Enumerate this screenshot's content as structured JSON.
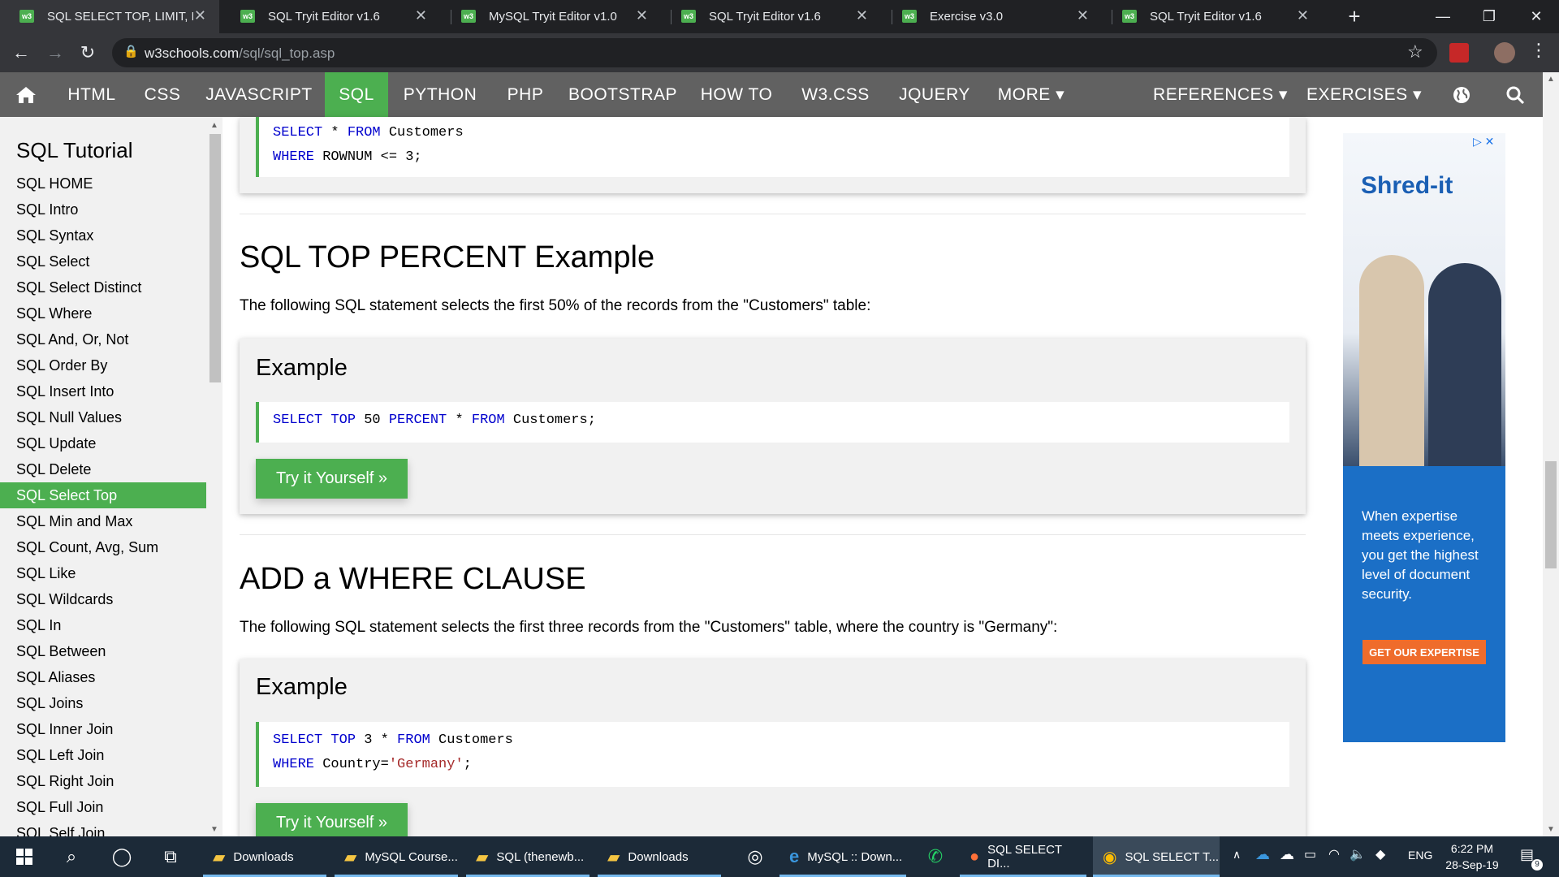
{
  "browser": {
    "tabs": [
      {
        "title": "SQL SELECT TOP, LIMIT, ROWNUM",
        "active": true
      },
      {
        "title": "SQL Tryit Editor v1.6"
      },
      {
        "title": "MySQL Tryit Editor v1.0"
      },
      {
        "title": "SQL Tryit Editor v1.6"
      },
      {
        "title": "Exercise v3.0"
      },
      {
        "title": "SQL Tryit Editor v1.6"
      }
    ],
    "new_tab_symbol": "+",
    "url_domain": "w3schools.com",
    "url_path": "/sql/sql_top.asp"
  },
  "nav": {
    "items": [
      "HTML",
      "CSS",
      "JAVASCRIPT",
      "SQL",
      "PYTHON",
      "PHP",
      "BOOTSTRAP",
      "HOW TO",
      "W3.CSS",
      "JQUERY",
      "MORE ▾"
    ],
    "references": "REFERENCES ▾",
    "exercises": "EXERCISES ▾"
  },
  "sidebar": {
    "title": "SQL Tutorial",
    "items": [
      "SQL HOME",
      "SQL Intro",
      "SQL Syntax",
      "SQL Select",
      "SQL Select Distinct",
      "SQL Where",
      "SQL And, Or, Not",
      "SQL Order By",
      "SQL Insert Into",
      "SQL Null Values",
      "SQL Update",
      "SQL Delete",
      "SQL Select Top",
      "SQL Min and Max",
      "SQL Count, Avg, Sum",
      "SQL Like",
      "SQL Wildcards",
      "SQL In",
      "SQL Between",
      "SQL Aliases",
      "SQL Joins",
      "SQL Inner Join",
      "SQL Left Join",
      "SQL Right Join",
      "SQL Full Join",
      "SQL Self Join"
    ],
    "active_index": 12
  },
  "main": {
    "top_code": {
      "line1": {
        "kw1": "SELECT",
        "t1": " * ",
        "kw2": "FROM",
        "t2": " Customers"
      },
      "line2": {
        "kw1": "WHERE",
        "t1": " ROWNUM <= 3;"
      }
    },
    "section1": {
      "heading": "SQL TOP PERCENT Example",
      "description": "The following SQL statement selects the first 50% of the records from the \"Customers\" table:",
      "example_label": "Example",
      "code": {
        "kw1": "SELECT",
        "sp1": " ",
        "kw2": "TOP",
        "t1": " 50 ",
        "kw3": "PERCENT",
        "t2": " * ",
        "kw4": "FROM",
        "t3": " Customers;"
      },
      "try_label": "Try it Yourself »"
    },
    "section2": {
      "heading": "ADD a WHERE CLAUSE",
      "description": "The following SQL statement selects the first three records from the \"Customers\" table, where the country is \"Germany\":",
      "example_label": "Example",
      "code_line1": {
        "kw1": "SELECT",
        "sp1": " ",
        "kw2": "TOP",
        "t1": " 3 * ",
        "kw3": "FROM",
        "t2": " Customers"
      },
      "code_line2": {
        "kw1": "WHERE",
        "t1": " Country=",
        "str": "'Germany'",
        "t2": ";"
      },
      "try_label": "Try it Yourself »"
    }
  },
  "ad": {
    "logo": "Shred-it",
    "text": "When expertise meets experience, you get the highest level of document security.",
    "button": "GET OUR EXPERTISE"
  },
  "taskbar": {
    "items": [
      {
        "label": "Downloads"
      },
      {
        "label": "MySQL Course..."
      },
      {
        "label": "SQL (thenewb..."
      },
      {
        "label": "Downloads"
      },
      {
        "label": "MySQL :: Down..."
      },
      {
        "label": "SQL SELECT DI..."
      },
      {
        "label": "SQL SELECT T..."
      }
    ],
    "language": "ENG",
    "time": "6:22 PM",
    "date": "28-Sep-19",
    "notification_count": "9"
  }
}
